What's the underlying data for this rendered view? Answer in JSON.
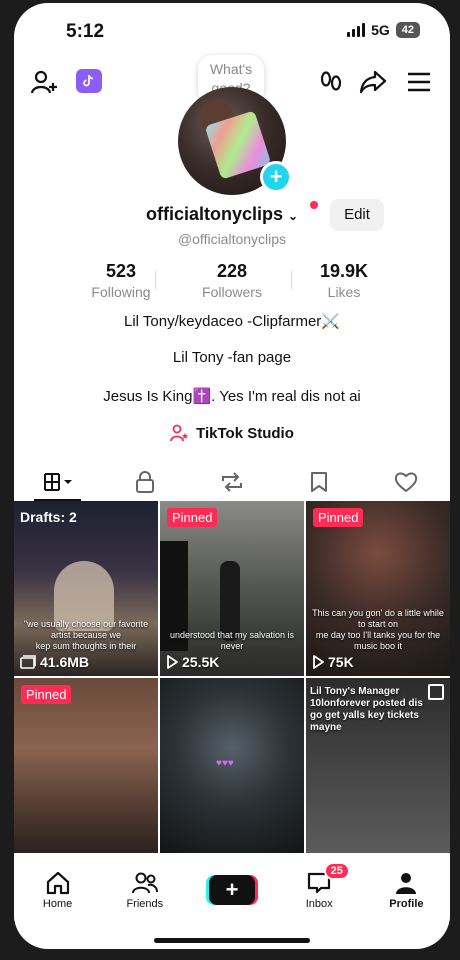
{
  "status_bar": {
    "time": "5:12",
    "network": "5G",
    "battery": "42"
  },
  "header": {
    "status_bubble": "What's good?"
  },
  "profile": {
    "username": "officialtonyclips",
    "handle": "@officialtonyclips",
    "edit_label": "Edit",
    "stats": [
      {
        "value": "523",
        "label": "Following"
      },
      {
        "value": "228",
        "label": "Followers"
      },
      {
        "value": "19.9K",
        "label": "Likes"
      }
    ],
    "bio_lines": [
      "Lil Tony/keydaceo -Clipfarmer⚔️",
      "Lil Tony -fan page",
      "Jesus Is King✝️. Yes I'm real dis not ai"
    ],
    "studio_label": "TikTok Studio"
  },
  "tabs": [
    "videos-grid",
    "private",
    "reposts",
    "saved",
    "liked"
  ],
  "grid": [
    {
      "badge": "Drafts: 2",
      "caption": "\"we usually choose our favorite artist because we\nkep sum thoughts in their",
      "views": "41.6MB"
    },
    {
      "badge": "Pinned",
      "caption": "understood that my salvation is never",
      "views": "25.5K"
    },
    {
      "badge": "Pinned",
      "caption": "This can you gon' do a little while to start on\nme day too I'll tanks you for the music boo it",
      "views": "75K"
    },
    {
      "badge": "Pinned",
      "caption": "",
      "views": ""
    },
    {
      "badge": "",
      "caption": "",
      "views": ""
    },
    {
      "badge": "",
      "caption": "Lil Tony's Manager\n10lonforever posted dis\ngo get yalls key tickets\nmayne",
      "views": ""
    }
  ],
  "bottom_nav": [
    {
      "label": "Home"
    },
    {
      "label": "Friends"
    },
    {
      "label": ""
    },
    {
      "label": "Inbox",
      "badge": "25"
    },
    {
      "label": "Profile"
    }
  ],
  "colors": {
    "accent": "#fe2c55",
    "cyan": "#25f4ee",
    "badge_blue": "#20d5ec"
  }
}
